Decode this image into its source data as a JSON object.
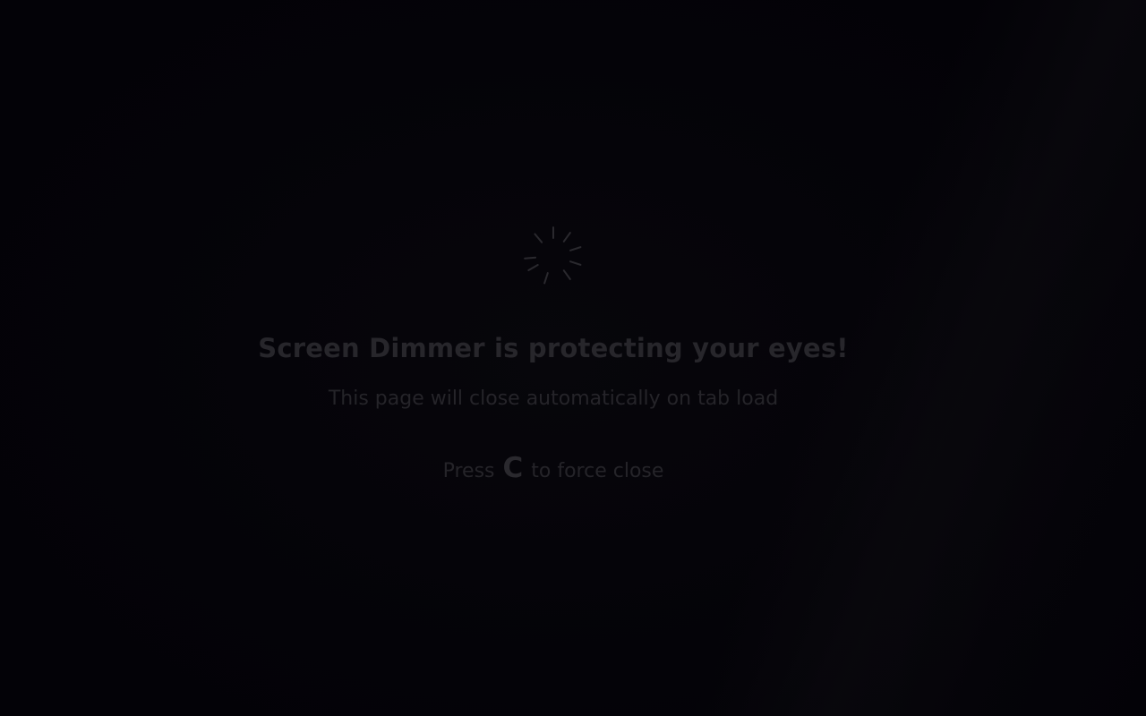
{
  "dimmer": {
    "title": "Screen Dimmer is protecting your eyes!",
    "subtitle": "This page will close automatically on tab load",
    "hint_prefix": "Press",
    "hint_key": "C",
    "hint_suffix": "to force close",
    "spinner_icon": "loading-spinner-icon"
  },
  "colors": {
    "background": "#040308",
    "text": "#27262b",
    "spinner": "#2a292e"
  }
}
